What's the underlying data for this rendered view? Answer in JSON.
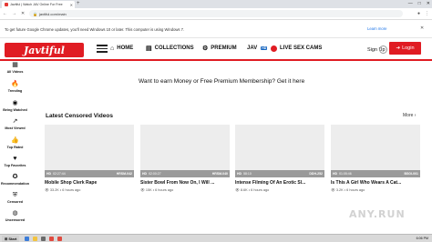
{
  "browser": {
    "tab_title": "Javtiful | Watch JAV Online For Free",
    "new_tab_symbol": "+",
    "url": "javtiful.com/main",
    "window_buttons": [
      "—",
      "□",
      "✕"
    ]
  },
  "infobar": {
    "message": "To get future Google Chrome updates, you'll need Windows 10 or later. This computer is using Windows 7.",
    "learn_more": "Learn more",
    "close": "✕"
  },
  "site": {
    "logo": "Javtiful",
    "nav": {
      "home": "HOME",
      "collections": "COLLECTIONS",
      "premium": "PREMIUM",
      "jav": "JAV",
      "jav_badge": "HD",
      "live": "LIVE SEX CAMS"
    },
    "signup": "Sign Up",
    "login": "Login"
  },
  "sidebar": [
    {
      "label": "All Videos",
      "icon": "grid-icon",
      "glyph": "▦"
    },
    {
      "label": "Trending",
      "icon": "fire-icon",
      "glyph": "🔥"
    },
    {
      "label": "Being Watched",
      "icon": "eye-icon",
      "glyph": "◉"
    },
    {
      "label": "Most Viewed",
      "icon": "chart-icon",
      "glyph": "↗"
    },
    {
      "label": "Top Rated",
      "icon": "thumbs-up-icon",
      "glyph": "👍"
    },
    {
      "label": "Top Favorites",
      "icon": "heart-icon",
      "glyph": "♥"
    },
    {
      "label": "Recommendation",
      "icon": "star-icon",
      "glyph": "✪"
    },
    {
      "label": "Censored",
      "icon": "shield-icon",
      "glyph": "⛨"
    },
    {
      "label": "Uncensored",
      "icon": "unlock-icon",
      "glyph": "◍"
    }
  ],
  "promo": "Want to earn Money or Free Premium Membership? Get it here",
  "section": {
    "title": "Latest Censored Videos",
    "more": "More"
  },
  "videos": [
    {
      "hd": "HD",
      "duration": "02:27:44",
      "code": "HRSM-042",
      "title": "Mobile Shop Clerk Rape",
      "views": "33.2K",
      "age": "6 hours ago"
    },
    {
      "hd": "HD",
      "duration": "02:00:27",
      "code": "HRSM-040",
      "title": "Sister Bowl From Now On, I Will ...",
      "views": "15K",
      "age": "6 hours ago"
    },
    {
      "hd": "HD",
      "duration": "58:10",
      "code": "DDH-252",
      "title": "Intense Filming Of An Erotic Sl...",
      "views": "8.6K",
      "age": "6 hours ago"
    },
    {
      "hd": "HD",
      "duration": "01:05:46",
      "code": "BSGI-001",
      "title": "Is This A Girl Who Wears A Cat...",
      "views": "3.2K",
      "age": "6 hours ago"
    }
  ],
  "watermark": "ANY.RUN",
  "taskbar": {
    "start": "Start",
    "clock": "6:06 PM"
  },
  "colors": {
    "brand": "#e01c23",
    "link": "#1a73e8"
  }
}
